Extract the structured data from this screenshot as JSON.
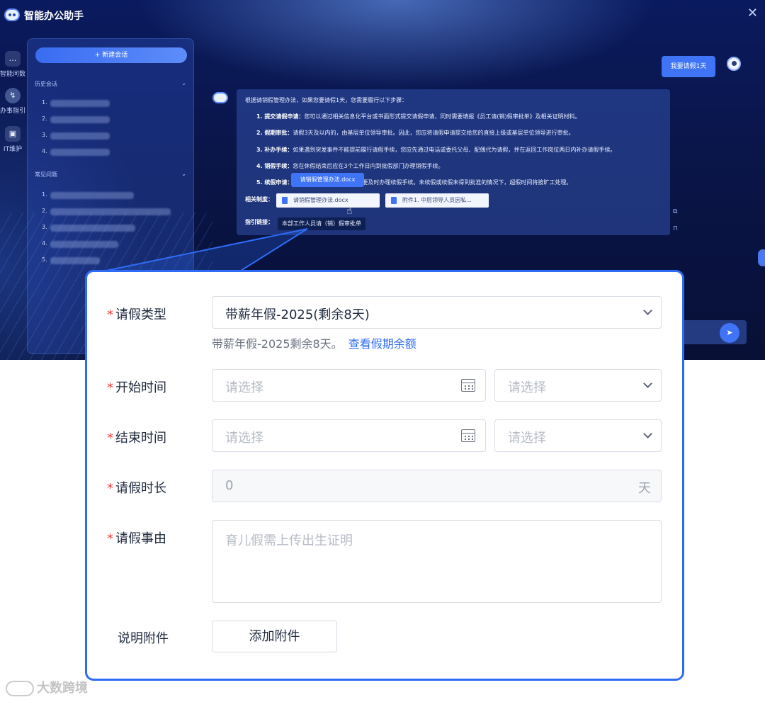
{
  "app": {
    "title": "智能办公助手",
    "nav": [
      {
        "label": "智能问数",
        "icon": "chat-bubble-icon"
      },
      {
        "label": "办事指引",
        "icon": "guide-icon"
      },
      {
        "label": "IT维护",
        "icon": "monitor-icon"
      }
    ],
    "history": {
      "new_chat_label": "+ 新建会话",
      "history_title": "历史会话",
      "history_items": [
        "1.",
        "2.",
        "3.",
        "4."
      ],
      "faq_title": "常见问题",
      "faq_items": [
        "1.",
        "2.",
        "3.",
        "4.",
        "5."
      ]
    },
    "chat": {
      "user_message": "我要请假1天",
      "answer_intro": "根据请销假管理办法，如果您要请假1天，您需要履行以下步骤：",
      "steps": [
        {
          "title": "1. 提交请假申请：",
          "text": "您可以通过相关信息化平台或书面形式提交请假申请，同时需要填报《员工请(销)假审批单》及相关证明材料。"
        },
        {
          "title": "2. 假期审批：",
          "text": "请假3天及以内的，由基层单位领导审批。因此，您应将请假申请提交给您的直接上级或基层单位领导进行审批。"
        },
        {
          "title": "3. 补办手续：",
          "text": "如果遇到突发事件不能提前履行请假手续，您应先通过电话或委托父母、配偶代为请假，并在返回工作岗位两日内补办请假手续。"
        },
        {
          "title": "4. 销假手续：",
          "text": "您在休假结束后应在3个工作日内到批假部门办理销假手续。"
        },
        {
          "title": "5. 续假申请：",
          "text": "工作，需要及时办理续假手续。未续假或续假未得到批准的情况下，超假时间将按旷工处理。"
        }
      ],
      "related_label": "相关制度：",
      "related_docs": [
        "请销假管理办法.docx",
        "附件1. 中层领导人员因私..."
      ],
      "guide_label": "指引链接：",
      "guide_link": "本部工作人员请（销）假审批单",
      "tooltip": "请销假管理办法.docx"
    }
  },
  "form": {
    "leave_type": {
      "label": "请假类型",
      "value": "带薪年假-2025(剩余8天)",
      "hint": "带薪年假-2025剩余8天。",
      "hint_link": "查看假期余额"
    },
    "start_time": {
      "label": "开始时间",
      "date_placeholder": "请选择",
      "period_placeholder": "请选择"
    },
    "end_time": {
      "label": "结束时间",
      "date_placeholder": "请选择",
      "period_placeholder": "请选择"
    },
    "duration": {
      "label": "请假时长",
      "value": "0",
      "unit": "天"
    },
    "reason": {
      "label": "请假事由",
      "placeholder": "育儿假需上传出生证明"
    },
    "attachment": {
      "label": "说明附件",
      "button": "添加附件"
    }
  },
  "colors": {
    "accent": "#2e6cf5",
    "required_star": "#f03b3b",
    "app_bg": "#0a1548"
  },
  "watermark": "大数跨境"
}
